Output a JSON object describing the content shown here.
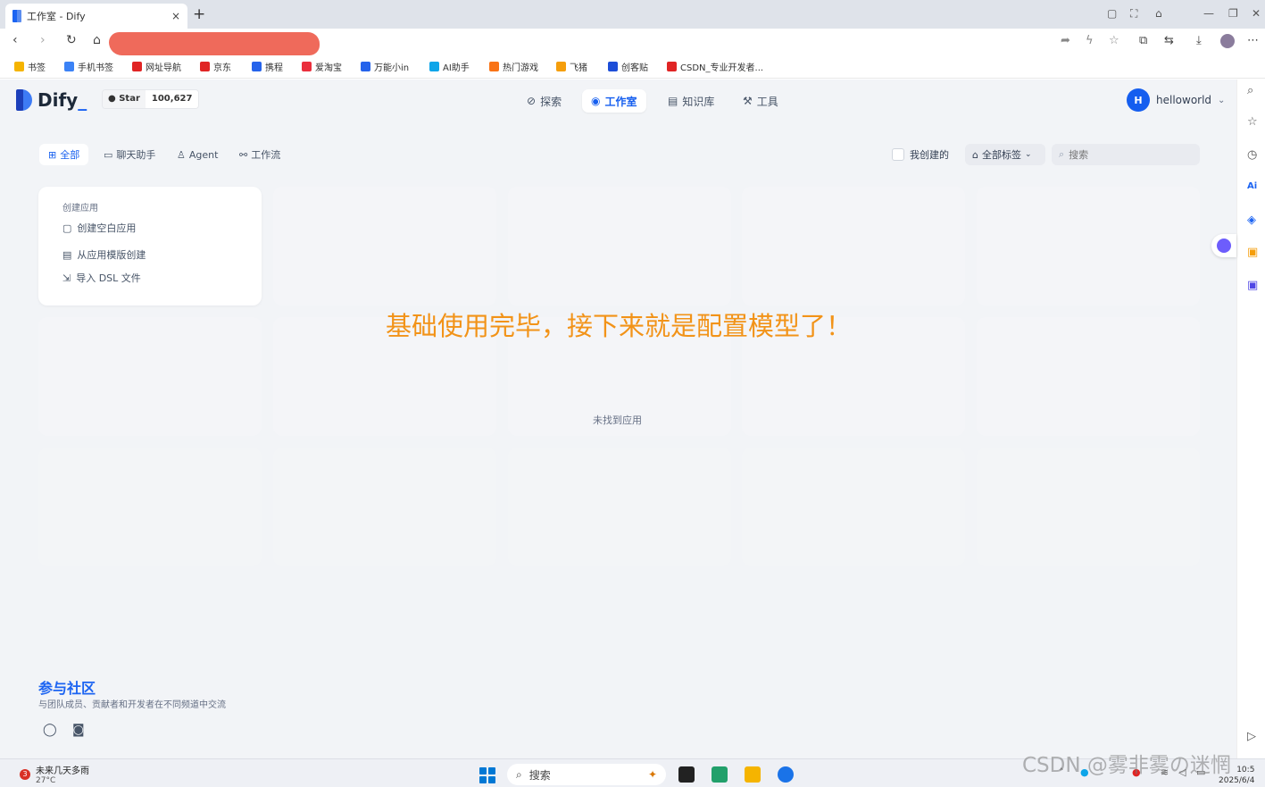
{
  "browser": {
    "tab_title": "工作室 - Dify",
    "tab_close": "×",
    "new_tab": "+",
    "bookmarks": [
      {
        "label": "书签",
        "color": "#f5b400"
      },
      {
        "label": "手机书签",
        "color": "#3b82f6"
      },
      {
        "label": "网址导航",
        "color": "#e02424"
      },
      {
        "label": "京东",
        "color": "#e02424"
      },
      {
        "label": "携程",
        "color": "#2563eb"
      },
      {
        "label": "爱淘宝",
        "color": "#ea2f3d"
      },
      {
        "label": "万能小in",
        "color": "#2563eb"
      },
      {
        "label": "AI助手",
        "color": "#0ea5e9"
      },
      {
        "label": "热门游戏",
        "color": "#f97316"
      },
      {
        "label": "飞猪",
        "color": "#f59e0b"
      },
      {
        "label": "创客贴",
        "color": "#1d4ed8"
      },
      {
        "label": "CSDN_专业开发者...",
        "color": "#e02424"
      }
    ]
  },
  "app": {
    "logo": "Dify",
    "github_star": "Star",
    "star_count": "100,627",
    "nav": {
      "explore": "探索",
      "studio": "工作室",
      "knowledge": "知识库",
      "tools": "工具"
    },
    "user": {
      "initial": "H",
      "name": "helloworld",
      "caret": "⌄"
    },
    "filters": {
      "all": "全部",
      "chat": "聊天助手",
      "agent": "Agent",
      "workflow": "工作流"
    },
    "created_by_me": "我创建的",
    "all_tags": "全部标签",
    "search_placeholder": "搜索",
    "create_card": {
      "heading": "创建应用",
      "blank": "创建空白应用",
      "template": "从应用模版创建",
      "import": "导入 DSL 文件"
    },
    "empty_text": "未找到应用",
    "overlay_text": "基础使用完毕，接下来就是配置模型了！",
    "community": {
      "title": "参与社区",
      "desc": "与团队成员、贡献者和开发者在不同频道中交流"
    }
  },
  "taskbar": {
    "weather_badge": "3",
    "weather_line1": "未来几天多雨",
    "weather_line2": "27°C",
    "search": "搜索",
    "time": "10:5",
    "date": "2025/6/4"
  },
  "watermark": "CSDN @雾非雾の迷惘"
}
